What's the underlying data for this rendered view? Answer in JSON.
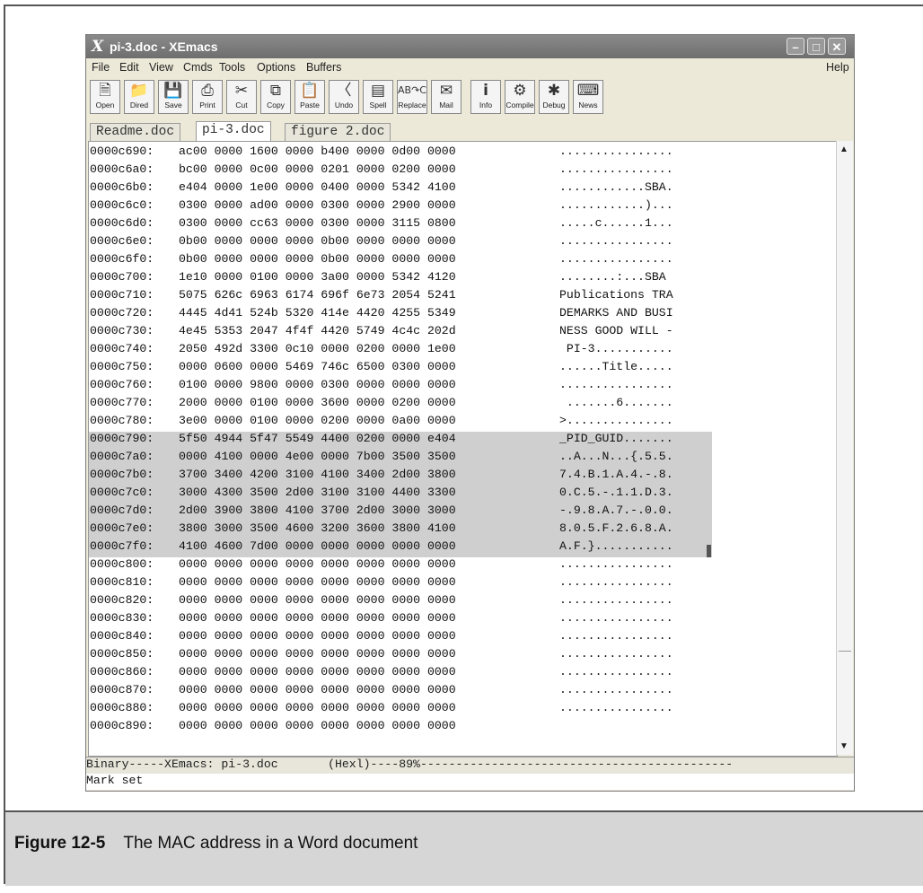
{
  "window": {
    "title": "pi-3.doc - XEmacs",
    "logo": "X",
    "controls": [
      "minimize",
      "maximize",
      "close"
    ]
  },
  "menu": {
    "items": [
      "File",
      "Edit",
      "View",
      "Cmds",
      "Tools",
      "Options",
      "Buffers"
    ],
    "help": "Help"
  },
  "toolbar": {
    "buttons": [
      {
        "label": "Open",
        "icon": "open-file-icon"
      },
      {
        "label": "Dired",
        "icon": "folder-icon"
      },
      {
        "label": "Save",
        "icon": "save-icon"
      },
      {
        "label": "Print",
        "icon": "printer-icon"
      },
      {
        "label": "Cut",
        "icon": "scissors-icon"
      },
      {
        "label": "Copy",
        "icon": "copy-icon"
      },
      {
        "label": "Paste",
        "icon": "paste-icon"
      },
      {
        "label": "Undo",
        "icon": "eraser-icon"
      },
      {
        "label": "Spell",
        "icon": "spell-icon"
      },
      {
        "label": "Replace",
        "icon": "replace-icon"
      },
      {
        "label": "Mail",
        "icon": "mail-icon"
      },
      {
        "label": "Info",
        "icon": "info-icon"
      },
      {
        "label": "Compile",
        "icon": "gears-icon"
      },
      {
        "label": "Debug",
        "icon": "bug-icon"
      },
      {
        "label": "News",
        "icon": "news-icon"
      }
    ]
  },
  "tabs": [
    "Readme.doc",
    "pi-3.doc",
    "figure 2.doc"
  ],
  "active_tab": "pi-3.doc",
  "hex": {
    "lines": [
      {
        "addr": "0000c690:",
        "hex": "ac00 0000 1600 0000 b400 0000 0d00 0000",
        "ascii": "................"
      },
      {
        "addr": "0000c6a0:",
        "hex": "bc00 0000 0c00 0000 0201 0000 0200 0000",
        "ascii": "................"
      },
      {
        "addr": "0000c6b0:",
        "hex": "e404 0000 1e00 0000 0400 0000 5342 4100",
        "ascii": "............SBA."
      },
      {
        "addr": "0000c6c0:",
        "hex": "0300 0000 ad00 0000 0300 0000 2900 0000",
        "ascii": "............)..."
      },
      {
        "addr": "0000c6d0:",
        "hex": "0300 0000 cc63 0000 0300 0000 3115 0800",
        "ascii": ".....c......1..."
      },
      {
        "addr": "0000c6e0:",
        "hex": "0b00 0000 0000 0000 0b00 0000 0000 0000",
        "ascii": "................"
      },
      {
        "addr": "0000c6f0:",
        "hex": "0b00 0000 0000 0000 0b00 0000 0000 0000",
        "ascii": "................"
      },
      {
        "addr": "0000c700:",
        "hex": "1e10 0000 0100 0000 3a00 0000 5342 4120",
        "ascii": "........:...SBA "
      },
      {
        "addr": "0000c710:",
        "hex": "5075 626c 6963 6174 696f 6e73 2054 5241",
        "ascii": "Publications TRA"
      },
      {
        "addr": "0000c720:",
        "hex": "4445 4d41 524b 5320 414e 4420 4255 5349",
        "ascii": "DEMARKS AND BUSI"
      },
      {
        "addr": "0000c730:",
        "hex": "4e45 5353 2047 4f4f 4420 5749 4c4c 202d",
        "ascii": "NESS GOOD WILL -"
      },
      {
        "addr": "0000c740:",
        "hex": "2050 492d 3300 0c10 0000 0200 0000 1e00",
        "ascii": " PI-3..........."
      },
      {
        "addr": "0000c750:",
        "hex": "0000 0600 0000 5469 746c 6500 0300 0000",
        "ascii": "......Title....."
      },
      {
        "addr": "0000c760:",
        "hex": "0100 0000 9800 0000 0300 0000 0000 0000",
        "ascii": "................"
      },
      {
        "addr": "0000c770:",
        "hex": "2000 0000 0100 0000 3600 0000 0200 0000",
        "ascii": " .......6......."
      },
      {
        "addr": "0000c780:",
        "hex": "3e00 0000 0100 0000 0200 0000 0a00 0000",
        "ascii": ">..............."
      },
      {
        "addr": "0000c790:",
        "hex": "5f50 4944 5f47 5549 4400 0200 0000 e404",
        "ascii": "_PID_GUID......."
      },
      {
        "addr": "0000c7a0:",
        "hex": "0000 4100 0000 4e00 0000 7b00 3500 3500",
        "ascii": "..A...N...{.5.5."
      },
      {
        "addr": "0000c7b0:",
        "hex": "3700 3400 4200 3100 4100 3400 2d00 3800",
        "ascii": "7.4.B.1.A.4.-.8."
      },
      {
        "addr": "0000c7c0:",
        "hex": "3000 4300 3500 2d00 3100 3100 4400 3300",
        "ascii": "0.C.5.-.1.1.D.3."
      },
      {
        "addr": "0000c7d0:",
        "hex": "2d00 3900 3800 4100 3700 2d00 3000 3000",
        "ascii": "-.9.8.A.7.-.0.0."
      },
      {
        "addr": "0000c7e0:",
        "hex": "3800 3000 3500 4600 3200 3600 3800 4100",
        "ascii": "8.0.5.F.2.6.8.A."
      },
      {
        "addr": "0000c7f0:",
        "hex": "4100 4600 7d00 0000 0000 0000 0000 0000",
        "ascii": "A.F.}..........."
      },
      {
        "addr": "0000c800:",
        "hex": "0000 0000 0000 0000 0000 0000 0000 0000",
        "ascii": "................"
      },
      {
        "addr": "0000c810:",
        "hex": "0000 0000 0000 0000 0000 0000 0000 0000",
        "ascii": "................"
      },
      {
        "addr": "0000c820:",
        "hex": "0000 0000 0000 0000 0000 0000 0000 0000",
        "ascii": "................"
      },
      {
        "addr": "0000c830:",
        "hex": "0000 0000 0000 0000 0000 0000 0000 0000",
        "ascii": "................"
      },
      {
        "addr": "0000c840:",
        "hex": "0000 0000 0000 0000 0000 0000 0000 0000",
        "ascii": "................"
      },
      {
        "addr": "0000c850:",
        "hex": "0000 0000 0000 0000 0000 0000 0000 0000",
        "ascii": "................"
      },
      {
        "addr": "0000c860:",
        "hex": "0000 0000 0000 0000 0000 0000 0000 0000",
        "ascii": "................"
      },
      {
        "addr": "0000c870:",
        "hex": "0000 0000 0000 0000 0000 0000 0000 0000",
        "ascii": "................"
      },
      {
        "addr": "0000c880:",
        "hex": "0000 0000 0000 0000 0000 0000 0000 0000",
        "ascii": "................"
      },
      {
        "addr": "0000c890:",
        "hex": "0000 0000 0000 0000 0000 0000 0000 0000",
        "ascii": ""
      }
    ]
  },
  "modeline": "Binary-----XEmacs: pi-3.doc       (Hexl)----89%--------------------------------------------",
  "echo": "Mark set",
  "caption": {
    "number": "Figure 12-5",
    "text": "The MAC address in a Word document"
  },
  "colors": {
    "titlebar": "#7c7c7c",
    "chrome": "#ece9d8",
    "selection": "#cfcfcf",
    "caption_band": "#d6d6d6"
  }
}
